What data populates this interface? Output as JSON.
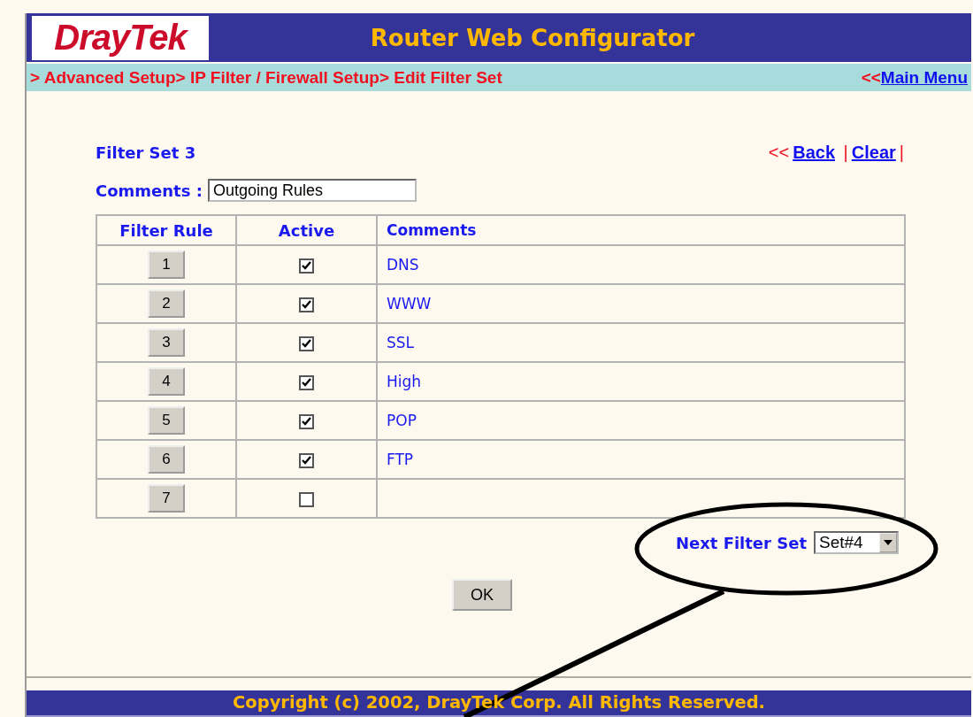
{
  "header": {
    "logo": "DrayTek",
    "title": "Router Web Configurator"
  },
  "breadcrumb": {
    "path": "> Advanced Setup> IP Filter / Firewall Setup> Edit Filter Set",
    "prefix": "<<",
    "main_menu": "Main Menu"
  },
  "filter_set": {
    "title": "Filter Set 3",
    "back_prefix": "<<",
    "back": "Back",
    "separator": "|",
    "clear": "Clear",
    "separator_end": "|"
  },
  "comments": {
    "label": "Comments :",
    "value": "Outgoing Rules"
  },
  "table": {
    "columns": [
      "Filter Rule",
      "Active",
      "Comments"
    ],
    "rows": [
      {
        "rule": "1",
        "active": true,
        "comment": "DNS"
      },
      {
        "rule": "2",
        "active": true,
        "comment": "WWW"
      },
      {
        "rule": "3",
        "active": true,
        "comment": "SSL"
      },
      {
        "rule": "4",
        "active": true,
        "comment": "High"
      },
      {
        "rule": "5",
        "active": true,
        "comment": "POP"
      },
      {
        "rule": "6",
        "active": true,
        "comment": "FTP"
      },
      {
        "rule": "7",
        "active": false
      }
    ]
  },
  "next_filter_set": {
    "label": "Next Filter Set",
    "value": "Set#4"
  },
  "ok_button": "OK",
  "footer": "Copyright (c) 2002, DrayTek Corp. All Rights Reserved."
}
